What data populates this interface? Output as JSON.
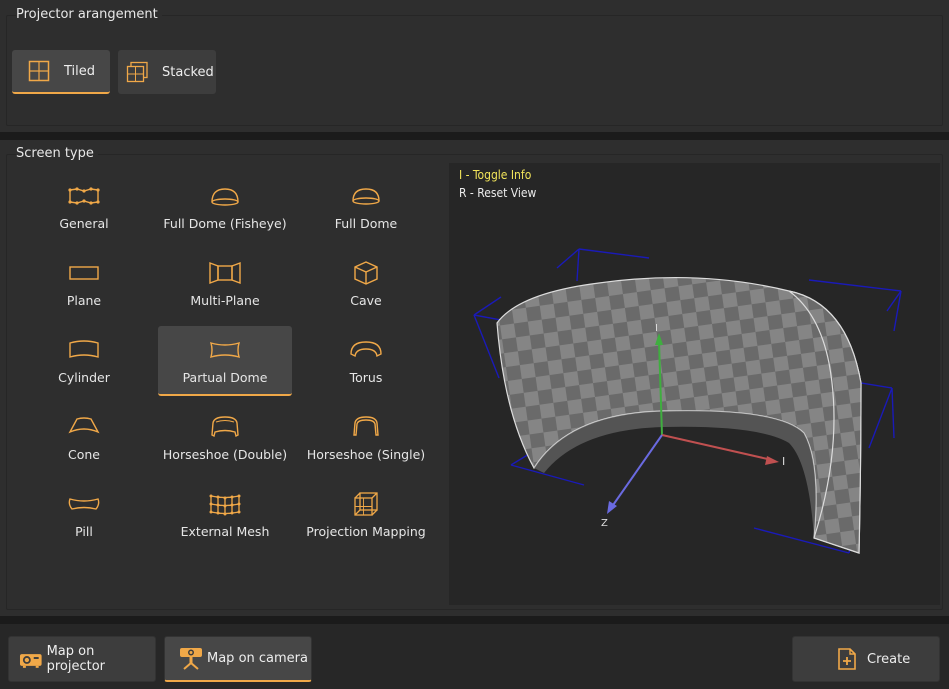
{
  "projector_arrangement": {
    "title": "Projector arangement",
    "buttons": [
      {
        "label": "Tiled",
        "icon": "tiled-icon",
        "active": true
      },
      {
        "label": "Stacked",
        "icon": "stacked-icon",
        "active": false
      }
    ]
  },
  "screen_type": {
    "title": "Screen type",
    "selected": "Partual Dome",
    "items": [
      {
        "label": "General",
        "icon": "general-icon"
      },
      {
        "label": "Full Dome (Fisheye)",
        "icon": "fisheye-dome-icon"
      },
      {
        "label": "Full Dome",
        "icon": "dome-icon"
      },
      {
        "label": "Plane",
        "icon": "plane-icon"
      },
      {
        "label": "Multi-Plane",
        "icon": "multi-plane-icon"
      },
      {
        "label": "Cave",
        "icon": "cave-icon"
      },
      {
        "label": "Cylinder",
        "icon": "cylinder-icon"
      },
      {
        "label": "Partual Dome",
        "icon": "partial-dome-icon"
      },
      {
        "label": "Torus",
        "icon": "torus-icon"
      },
      {
        "label": "Cone",
        "icon": "cone-icon"
      },
      {
        "label": "Horseshoe (Double)",
        "icon": "horseshoe-double-icon"
      },
      {
        "label": "Horseshoe (Single)",
        "icon": "horseshoe-single-icon"
      },
      {
        "label": "Pill",
        "icon": "pill-icon"
      },
      {
        "label": "External Mesh",
        "icon": "external-mesh-icon"
      },
      {
        "label": "Projection Mapping",
        "icon": "projection-mapping-icon"
      }
    ]
  },
  "viewport": {
    "info_toggle": "I - Toggle Info",
    "reset_view": "R - Reset View",
    "axis_labels": {
      "x": "I",
      "y": "I",
      "z": "Z"
    }
  },
  "bottom": {
    "map_projector": "Map on projector",
    "map_camera": "Map on camera",
    "create": "Create"
  },
  "colors": {
    "accent": "#f0a848",
    "info_yellow": "#f2e45a",
    "axis_x": "#c05050",
    "axis_y": "#3fae3f",
    "axis_z": "#6a6ae0",
    "wire": "#1a1ab8"
  }
}
